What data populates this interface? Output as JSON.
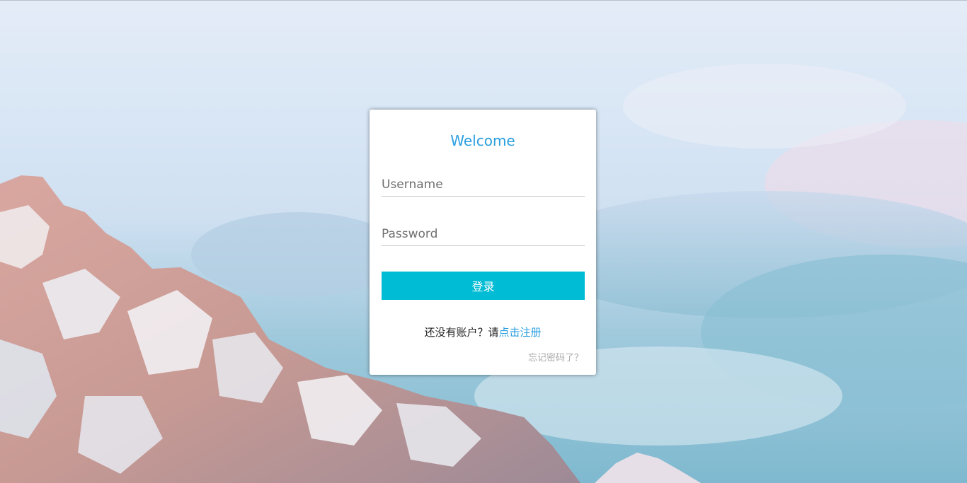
{
  "login": {
    "title": "Welcome",
    "username_placeholder": "Username",
    "password_placeholder": "Password",
    "submit_label": "登录",
    "register_prompt": "还没有账户？请",
    "register_link": "点击注册",
    "forgot_link": "忘记密码了？"
  },
  "colors": {
    "accent": "#2a9fe0",
    "button": "#00bcd4"
  }
}
